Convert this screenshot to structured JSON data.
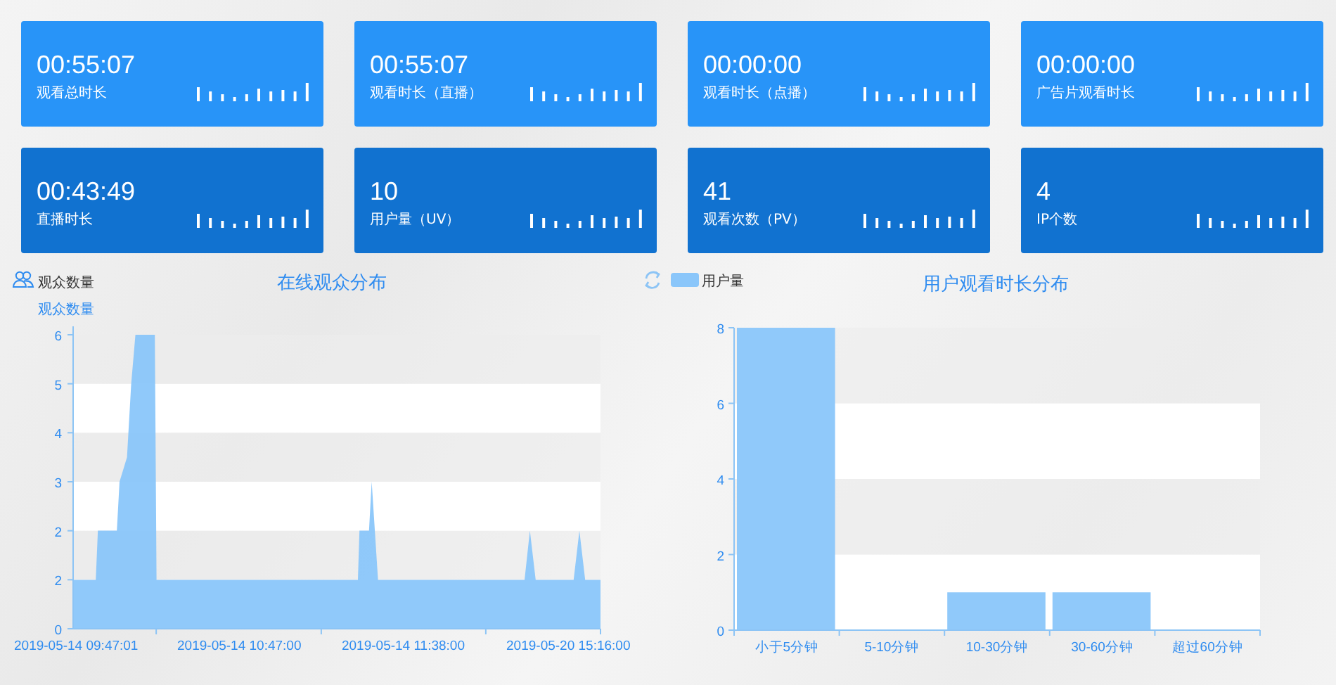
{
  "cards": [
    {
      "value": "00:55:07",
      "label": "观看总时长",
      "color": "#2894f8"
    },
    {
      "value": "00:55:07",
      "label": "观看时长（直播）",
      "color": "#2894f8"
    },
    {
      "value": "00:00:00",
      "label": "观看时长（点播）",
      "color": "#2894f8"
    },
    {
      "value": "00:00:00",
      "label": "广告片观看时长",
      "color": "#2894f8"
    },
    {
      "value": "00:43:49",
      "label": "直播时长",
      "color": "#1172d0"
    },
    {
      "value": "10",
      "label": "用户量（UV）",
      "color": "#1172d0"
    },
    {
      "value": "41",
      "label": "观看次数（PV）",
      "color": "#1172d0"
    },
    {
      "value": "4",
      "label": "IP个数",
      "color": "#1172d0"
    }
  ],
  "online_chart": {
    "legend_label": "观众数量",
    "title": "在线观众分布",
    "axis_title": "观众数量",
    "y_tick_labels": [
      "6",
      "5",
      "4",
      "3",
      "2",
      "2",
      "0"
    ],
    "x_axis_labels": [
      "2019-05-14 09:47:01",
      "2019-05-14 10:47:00",
      "2019-05-14 11:38:00",
      "2019-05-20 15:16:00"
    ]
  },
  "duration_chart": {
    "chart_data": {
      "type": "bar",
      "title": "用户观看时长分布",
      "categories": [
        "小于5分钟",
        "5-10分钟",
        "10-30分钟",
        "30-60分钟",
        "超过60分钟"
      ],
      "series": [
        {
          "name": "用户量",
          "color": "#8ac6fa",
          "values": [
            8,
            0,
            1,
            1,
            0
          ]
        }
      ],
      "ylim": [
        0,
        8
      ],
      "yticks": [
        0,
        2,
        4,
        6,
        8
      ]
    }
  }
}
